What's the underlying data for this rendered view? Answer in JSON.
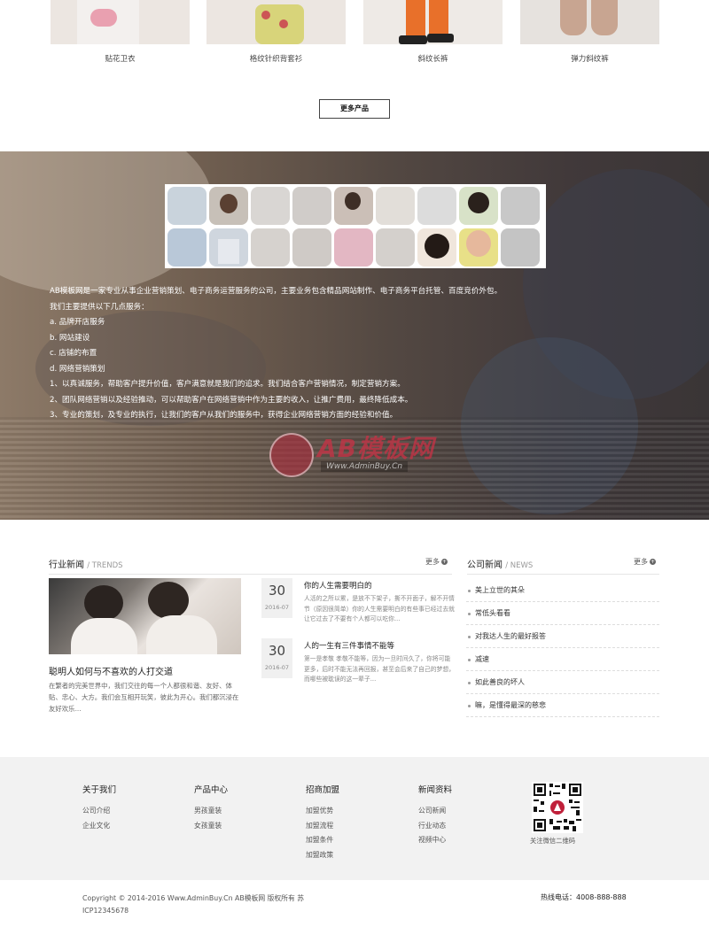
{
  "products": [
    {
      "name": "贴花卫衣"
    },
    {
      "name": "格纹针织背套衫"
    },
    {
      "name": "斜纹长裤"
    },
    {
      "name": "弹力斜纹裤"
    }
  ],
  "more_products_label": "更多产品",
  "hero": {
    "lines": [
      "AB模板网是一家专业从事企业营销策划、电子商务运营服务的公司，主要业务包含精品网站制作、电子商务平台托管、百度竞价外包。",
      "我们主要提供以下几点服务：",
      "a. 品牌开店服务",
      "b. 网站建设",
      "c. 店铺的布置",
      "d. 网络营销策划",
      "1、以真诚服务，帮助客户提升价值，客户满意就是我们的追求。我们结合客户营销情况，制定营销方案。",
      "2、团队网络营销以及经验推动，可以帮助客户在网络营销中作为主要的收入，让推广费用，最终降低成本。",
      "3、专业的策划，及专业的执行，让我们的客户从我们的服务中，获得企业网络营销方面的经验和价值。"
    ],
    "logo_text": "AB模板网",
    "logo_url": "Www.AdminBuy.Cn"
  },
  "industry_news": {
    "title": "行业新闻",
    "subtitle": "/ TRENDS",
    "more": "更多",
    "featured": {
      "title": "聪明人如何与不喜欢的人打交道",
      "desc": "在繁者的完美世界中，我们交往的每一个人都很和谐、友好、体贴、忠心、大方。我们会互相开玩笑，彼此为开心。我们都沉浸在友好欢乐..."
    },
    "items": [
      {
        "day": "30",
        "ym": "2016-07",
        "title": "你的人生需要明白的",
        "desc": "人活的之所以累，是放不下架子，撕不开面子，解不开情节（原因很简单）你的人生需要明白的有些事已经过去就让它过去了不要有个人都可以吃你..."
      },
      {
        "day": "30",
        "ym": "2016-07",
        "title": "人的一生有三件事情不能等",
        "desc": "第一是孝敬 孝敬不能等，因为一旦时间久了，你将可能更多，后时不能无法再回报，甚至会后来了自己的梦想，而哪些被耽误的这一辈子..."
      }
    ]
  },
  "company_news": {
    "title": "公司新闻",
    "subtitle": "/ NEWS",
    "more": "更多",
    "items": [
      {
        "label": "美上立世的其朵"
      },
      {
        "label": "常低头看看"
      },
      {
        "label": "对我达人生的最好报答"
      },
      {
        "label": "减速"
      },
      {
        "label": "如此善良的坏人"
      },
      {
        "label": "嘛，是懂得最深的慈悲"
      }
    ]
  },
  "footer": {
    "columns": [
      {
        "title": "关于我们",
        "links": [
          "公司介绍",
          "企业文化"
        ]
      },
      {
        "title": "产品中心",
        "links": [
          "男孩童装",
          "女孩童装"
        ]
      },
      {
        "title": "招商加盟",
        "links": [
          "加盟优势",
          "加盟流程",
          "加盟条件",
          "加盟政策"
        ]
      },
      {
        "title": "新闻资料",
        "links": [
          "公司新闻",
          "行业动态",
          "视频中心"
        ]
      }
    ],
    "qr_caption": "关注微信二维码",
    "copyright": "Copyright © 2014-2016 Www.AdminBuy.Cn AB模板网 版权所有 苏ICP12345678",
    "hotline": "热线电话：4008-888-888"
  }
}
